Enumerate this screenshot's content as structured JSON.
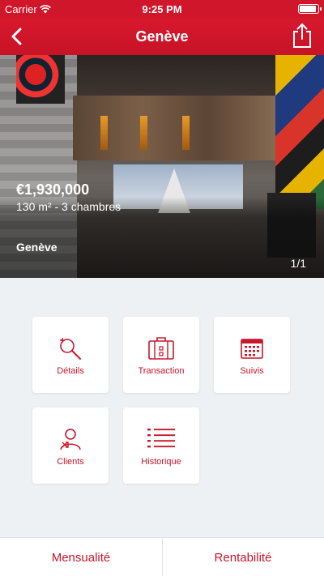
{
  "status_bar": {
    "carrier": "Carrier",
    "time": "9:25 PM"
  },
  "nav": {
    "title": "Genève",
    "back_icon": "chevron-left-icon",
    "share_icon": "share-icon"
  },
  "listing": {
    "price": "€1,930,000",
    "details": "130 m² - 3 chambres",
    "location": "Genève",
    "photo_counter": "1/1"
  },
  "tiles": [
    {
      "label": "Détails",
      "icon": "search-plus-icon"
    },
    {
      "label": "Transaction",
      "icon": "briefcase-icon"
    },
    {
      "label": "Suivis",
      "icon": "calendar-icon"
    },
    {
      "label": "Clients",
      "icon": "user-icon"
    },
    {
      "label": "Historique",
      "icon": "list-icon"
    }
  ],
  "bottom_bar": {
    "left_label": "Mensualité",
    "right_label": "Rentabilité"
  },
  "colors": {
    "accent": "#c8162b",
    "background": "#eef1f4"
  }
}
